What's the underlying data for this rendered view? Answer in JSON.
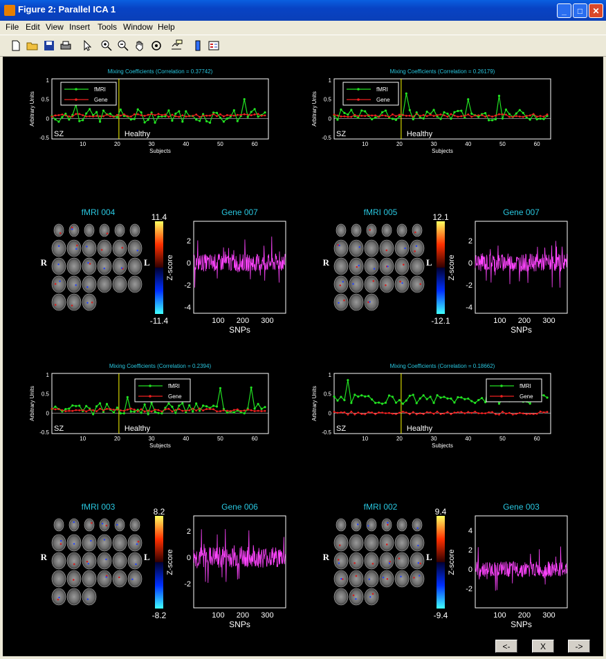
{
  "window": {
    "title": "Figure 2: Parallel ICA 1"
  },
  "menu": [
    "File",
    "Edit",
    "View",
    "Insert",
    "Tools",
    "Window",
    "Help"
  ],
  "toolbar_icons": [
    "new-file-icon",
    "open-folder-icon",
    "save-icon",
    "print-icon",
    "pointer-icon",
    "zoom-in-icon",
    "zoom-out-icon",
    "pan-hand-icon",
    "rotate-icon",
    "data-cursor-icon",
    "colorbar-icon",
    "legend-icon"
  ],
  "nav": {
    "prev": "<-",
    "close": "X",
    "next": "->"
  },
  "colors": {
    "cyan": "#29c7e0",
    "fmri": "#22e222",
    "gene": "#f02020",
    "snp": "#ff44ff",
    "divider": "#ffff00"
  },
  "mixing_plots": [
    {
      "title": "Mixing Coefficients (Correlation = 0.37742)",
      "ylabel": "Arbitrary Units",
      "xlabel": "Subjects",
      "legend": [
        "fMRI",
        "Gene"
      ],
      "group_labels": [
        "SZ",
        "Healthy"
      ],
      "xticks": [
        "10",
        "20",
        "30",
        "40",
        "50",
        "60"
      ],
      "yticks": [
        "1",
        "0.5",
        "0",
        "-0.5"
      ]
    },
    {
      "title": "Mixing Coefficients (Correlation = 0.26179)",
      "ylabel": "Arbitrary Units",
      "xlabel": "Subjects",
      "legend": [
        "fMRI",
        "Gene"
      ],
      "group_labels": [
        "SZ",
        "Healthy"
      ],
      "xticks": [
        "10",
        "20",
        "30",
        "40",
        "50",
        "60"
      ],
      "yticks": [
        "1",
        "0.5",
        "0",
        "-0.5"
      ]
    },
    {
      "title": "Mixing Coefficients (Correlation = 0.2394)",
      "ylabel": "Arbitrary Units",
      "xlabel": "Subjects",
      "legend": [
        "fMRI",
        "Gene"
      ],
      "group_labels": [
        "SZ",
        "Healthy"
      ],
      "xticks": [
        "10",
        "20",
        "30",
        "40",
        "50",
        "60"
      ],
      "yticks": [
        "1",
        "0.5",
        "0",
        "-0.5"
      ]
    },
    {
      "title": "Mixing Coefficients (Correlation = 0.18662)",
      "ylabel": "Arbitrary Units",
      "xlabel": "Subjects",
      "legend": [
        "fMRI",
        "Gene"
      ],
      "group_labels": [
        "SZ",
        "Healthy"
      ],
      "xticks": [
        "10",
        "20",
        "30",
        "40",
        "50",
        "60"
      ],
      "yticks": [
        "1",
        "0.5",
        "0",
        "-0.5"
      ]
    }
  ],
  "brain_panels": [
    {
      "title": "fMRI 004",
      "cb_max": "11.4",
      "cb_min": "-11.4",
      "cb_label": "Z-score",
      "left": "R",
      "right": "L"
    },
    {
      "title": "fMRI 005",
      "cb_max": "12.1",
      "cb_min": "-12.1",
      "cb_label": "Z-score",
      "left": "R",
      "right": "L"
    },
    {
      "title": "fMRI 003",
      "cb_max": "8.2",
      "cb_min": "-8.2",
      "cb_label": "Z-score",
      "left": "R",
      "right": "L"
    },
    {
      "title": "fMRI 002",
      "cb_max": "9.4",
      "cb_min": "-9.4",
      "cb_label": "Z-score",
      "left": "R",
      "right": "L"
    }
  ],
  "gene_panels": [
    {
      "title": "Gene 007",
      "xlabel": "SNPs",
      "yticks": [
        "2",
        "0",
        "-2",
        "-4"
      ],
      "xticks": [
        "100",
        "200",
        "300"
      ]
    },
    {
      "title": "Gene 007",
      "xlabel": "SNPs",
      "yticks": [
        "2",
        "0",
        "-2",
        "-4"
      ],
      "xticks": [
        "100",
        "200",
        "300"
      ]
    },
    {
      "title": "Gene 006",
      "xlabel": "SNPs",
      "yticks": [
        "2",
        "0",
        "-2"
      ],
      "xticks": [
        "100",
        "200",
        "300"
      ]
    },
    {
      "title": "Gene 003",
      "xlabel": "SNPs",
      "yticks": [
        "4",
        "2",
        "0",
        "-2"
      ],
      "xticks": [
        "100",
        "200",
        "300"
      ]
    }
  ]
}
